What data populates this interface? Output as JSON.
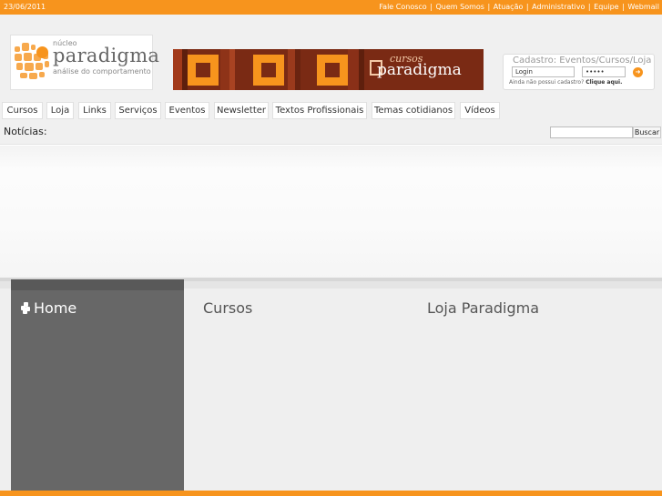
{
  "topbar": {
    "date": "23/06/2011",
    "links": [
      "Fale Conosco",
      "Quem Somos",
      "Atuação",
      "Administrativo",
      "Equipe",
      "Webmail"
    ],
    "separator": "|"
  },
  "logo": {
    "small": "núcleo",
    "name": "paradigma",
    "tagline": "análise do comportamento"
  },
  "banner": {
    "script": "cursos",
    "name": "paradigma"
  },
  "login": {
    "title": "Cadastro: Eventos/Cursos/Loja",
    "login_value": "Login",
    "password_value": "•••••",
    "no_account_text": "Ainda não possui cadastro?",
    "click_here": "Clique aqui."
  },
  "nav": {
    "items": [
      "Cursos",
      "Loja",
      "Links",
      "Serviços",
      "Eventos",
      "Newsletter",
      "Textos Profissionais",
      "Temas cotidianos",
      "Vídeos"
    ]
  },
  "news": {
    "label": "Notícias:",
    "search_value": "",
    "search_button": "Buscar"
  },
  "sidebar": {
    "home_label": "Home"
  },
  "columns": {
    "cursos_title": "Cursos",
    "loja_title": "Loja Paradigma"
  },
  "colors": {
    "accent": "#f7941d",
    "banner": "#7a2a14",
    "sidebar": "#676767"
  },
  "icons": [
    "home-icon",
    "go-arrow-icon",
    "logo-blocks-icon"
  ]
}
